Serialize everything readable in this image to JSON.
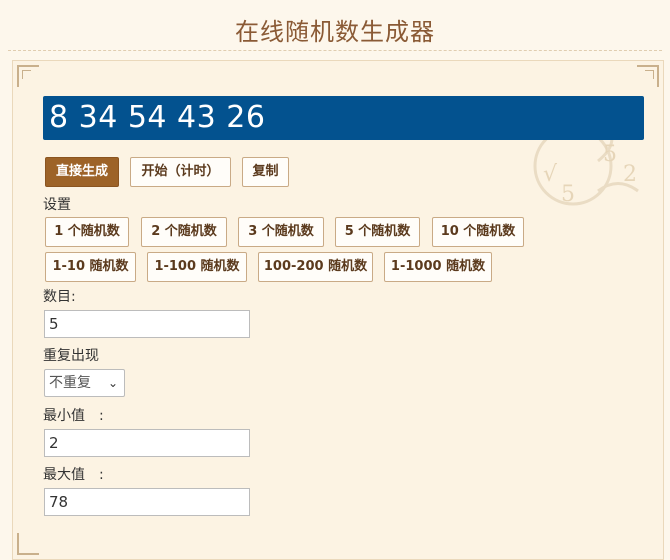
{
  "header": {
    "title": "在线随机数生成器"
  },
  "display": {
    "value": "8 34 54 43 26"
  },
  "actions": {
    "generate": "直接生成",
    "start": "开始（计时）",
    "copy": "复制"
  },
  "settings": {
    "label": "设置",
    "count_presets": [
      "1 个随机数",
      "2 个随机数",
      "3 个随机数",
      "5 个随机数",
      "10 个随机数"
    ],
    "range_presets": [
      "1-10 随机数",
      "1-100 随机数",
      "100-200 随机数",
      "1-1000 随机数"
    ]
  },
  "form": {
    "count_label": "数目:",
    "count_value": "5",
    "repeat_label": "重复出现",
    "repeat_selected": "不重复",
    "min_label": "最小值　:",
    "min_value": "2",
    "max_label": "最大值　:",
    "max_value": "78"
  },
  "colors": {
    "display_bg": "#03528f",
    "primary_button": "#9d6328",
    "title": "#8a5a35",
    "page_bg": "#fdf7ec"
  }
}
